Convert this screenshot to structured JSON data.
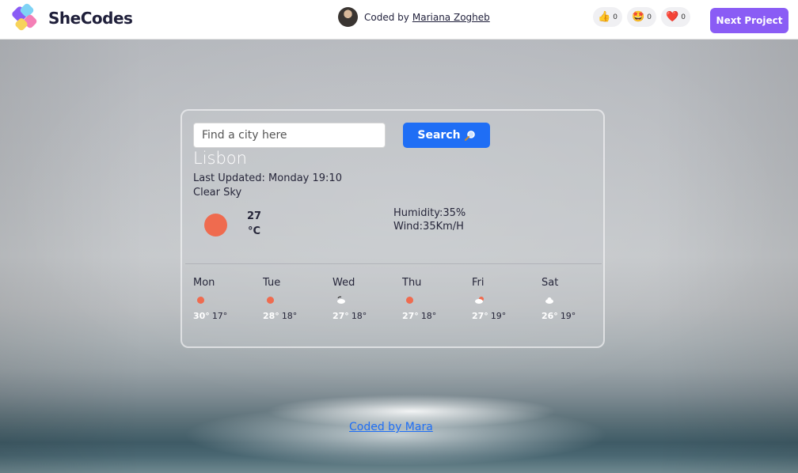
{
  "header": {
    "brand": "SheCodes",
    "coded_by_prefix": "Coded by",
    "author": "Mariana Zogheb",
    "reactions": [
      {
        "icon": "thumbs-up-icon",
        "glyph": "👍",
        "count": "0"
      },
      {
        "icon": "star-struck-icon",
        "glyph": "🤩",
        "count": "0"
      },
      {
        "icon": "heart-icon",
        "glyph": "❤️",
        "count": "0"
      }
    ],
    "next_button": "Next Project"
  },
  "weather": {
    "search_placeholder": "Find a city here",
    "search_button": "Search",
    "search_icon": "magnifier-icon",
    "city": "Lisbon",
    "last_updated": "Last Updated: Monday 19:10",
    "condition": "Clear Sky",
    "temperature": "27",
    "unit": "°C",
    "humidity": "Humidity:35%",
    "wind": "Wind:35Km/H",
    "forecast": [
      {
        "day": "Mon",
        "icon": "sun",
        "high": "30°",
        "low": "17°"
      },
      {
        "day": "Tue",
        "icon": "sun",
        "high": "28°",
        "low": "18°"
      },
      {
        "day": "Wed",
        "icon": "cloud-night",
        "high": "27°",
        "low": "18°"
      },
      {
        "day": "Thu",
        "icon": "sun",
        "high": "27°",
        "low": "18°"
      },
      {
        "day": "Fri",
        "icon": "sun-cloud",
        "high": "27°",
        "low": "19°"
      },
      {
        "day": "Sat",
        "icon": "cloud",
        "high": "26°",
        "low": "19°"
      }
    ]
  },
  "footer": {
    "link_text": "Coded by Mara"
  },
  "colors": {
    "accent_purple": "#8a5cf5",
    "search_blue": "#1f6ef5",
    "sun_orange": "#ef6b4f"
  }
}
